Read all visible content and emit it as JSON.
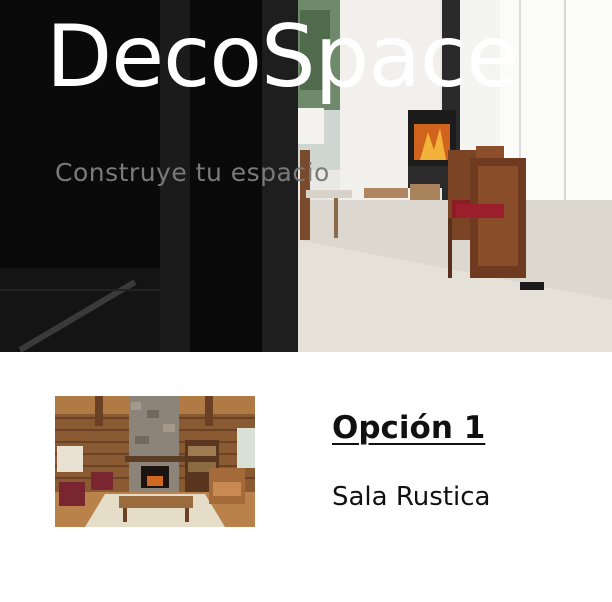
{
  "hero": {
    "title": "DecoSpace",
    "subtitle": "Construye tu espacio",
    "image": "modern-living-room-with-fireplace-photo"
  },
  "option": {
    "title": "Opción 1",
    "description": "Sala Rustica",
    "image": "rustic-log-cabin-living-room-photo"
  }
}
